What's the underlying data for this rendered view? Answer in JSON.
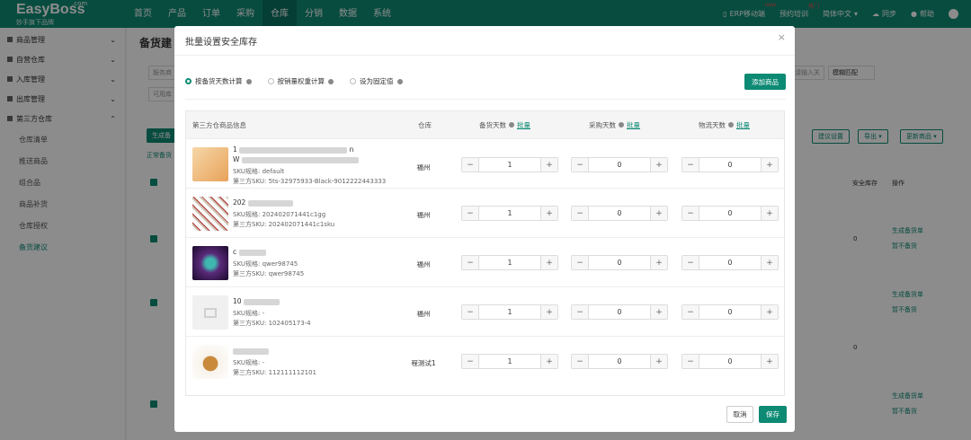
{
  "app": {
    "logo": "EasyBoss",
    "logo_com": ".com",
    "logo_sub": "妙手旗下品牌"
  },
  "nav": [
    "首页",
    "产品",
    "订单",
    "采购",
    "仓库",
    "分销",
    "数据",
    "系统"
  ],
  "topright": {
    "erp": "ERP移动端",
    "hot1": "new",
    "train": "预约培训",
    "hot2": "热门",
    "lang": "简体中文",
    "sync": "同步",
    "help": "帮助"
  },
  "sidebar": [
    {
      "label": "商品管理",
      "type": "group"
    },
    {
      "label": "自营仓库",
      "type": "group"
    },
    {
      "label": "入库管理",
      "type": "group"
    },
    {
      "label": "出库管理",
      "type": "group"
    },
    {
      "label": "第三方仓库",
      "type": "group"
    },
    {
      "label": "仓库清单",
      "type": "sub"
    },
    {
      "label": "推送商品",
      "type": "sub"
    },
    {
      "label": "组合品",
      "type": "sub"
    },
    {
      "label": "商品补货",
      "type": "sub"
    },
    {
      "label": "仓库授权",
      "type": "sub"
    },
    {
      "label": "备货建议",
      "type": "sub",
      "active": true
    }
  ],
  "bg": {
    "title": "备货建",
    "search_ph": "服务商",
    "select1": "可用库",
    "gen_btn": "生成备",
    "tab": "正常备货",
    "input_ph": "请输入关",
    "match": "模糊匹配",
    "btn_rule": "建议设置",
    "btn_export": "导出",
    "btn_update": "更新商品",
    "col_safe": "安全库存",
    "col_op": "操作",
    "op1": "生成备货单",
    "op2": "暂不备货",
    "zero": "0"
  },
  "modal": {
    "title": "批量设置安全库存",
    "close": "×",
    "radios": [
      "按备货天数计算",
      "按销量权重计算",
      "设为固定值"
    ],
    "add_btn": "添加商品",
    "headers": {
      "product": "第三方仓商品信息",
      "warehouse": "仓库",
      "stock_days": "备货天数",
      "purchase_days": "采购天数",
      "logistics_days": "物流天数",
      "batch": "批量"
    },
    "rows": [
      {
        "name_prefix": "1",
        "name_suffix": "n",
        "name_prefix2": "W",
        "sku_label": "SKU规格:",
        "sku": "default",
        "tp_label": "第三方SKU:",
        "tp_sku": "5ts-32975933-Black-9012222443333",
        "warehouse": "福州",
        "stock": "1",
        "purchase": "0",
        "logistics": "0"
      },
      {
        "name_prefix": "202",
        "sku_label": "SKU规格:",
        "sku": "202402071441c1gg",
        "tp_label": "第三方SKU:",
        "tp_sku": "202402071441c1sku",
        "warehouse": "福州",
        "stock": "1",
        "purchase": "0",
        "logistics": "0"
      },
      {
        "name_prefix": "c",
        "sku_label": "SKU规格:",
        "sku": "qwer98745",
        "tp_label": "第三方SKU:",
        "tp_sku": "qwer98745",
        "warehouse": "福州",
        "stock": "1",
        "purchase": "0",
        "logistics": "0"
      },
      {
        "name_prefix": "10",
        "sku_label": "SKU规格:",
        "sku": "-",
        "tp_label": "第三方SKU:",
        "tp_sku": "102405173-4",
        "warehouse": "福州",
        "stock": "1",
        "purchase": "0",
        "logistics": "0"
      },
      {
        "name_prefix": "",
        "sku_label": "SKU规格:",
        "sku": "-",
        "tp_label": "第三方SKU:",
        "tp_sku": "112111112101",
        "warehouse": "程测试1",
        "stock": "1",
        "purchase": "0",
        "logistics": "0"
      }
    ],
    "cancel": "取消",
    "save": "保存"
  },
  "colors": {
    "primary": "#0d8a74"
  }
}
